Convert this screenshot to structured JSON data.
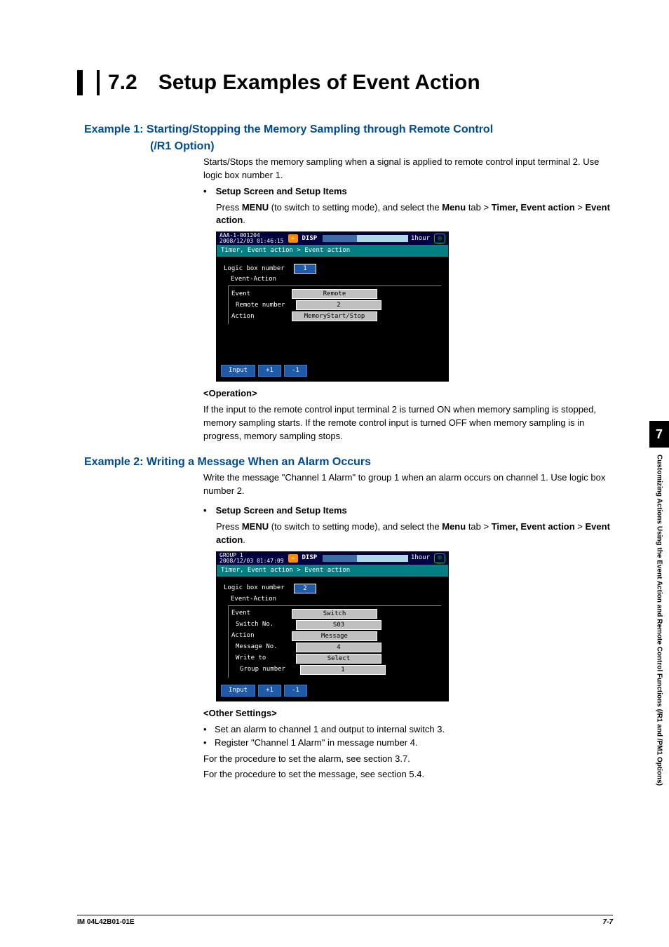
{
  "section": {
    "number": "7.2",
    "title": "Setup Examples of Event Action"
  },
  "example1": {
    "heading_line1": "Example 1: Starting/Stopping the Memory Sampling through Remote Control",
    "heading_line2": "(/R1 Option)",
    "intro": "Starts/Stops the memory sampling when a signal is applied to remote control input terminal 2. Use logic box number 1.",
    "setup_title": "Setup Screen and Setup Items",
    "setup_text_1": "Press ",
    "setup_menu": "MENU",
    "setup_text_2": " (to switch to setting mode), and select the ",
    "setup_menu_tab": "Menu",
    "setup_text_3": " tab > ",
    "setup_path1": "Timer, Event action",
    "setup_sep": " > ",
    "setup_path2": "Event action",
    "operation_title": "<Operation>",
    "operation_text": "If the input to the remote control input terminal 2 is turned ON when memory sampling is stopped, memory sampling starts. If the remote control input is turned OFF when memory sampling is in progress, memory sampling stops.",
    "screenshot": {
      "id_line1": "AAA-1-001204",
      "id_line2": "2008/12/03 01:46:15",
      "disp": "DISP",
      "hour": "1hour",
      "breadcrumb": "Timer, Event action > Event action",
      "rows": {
        "logic_label": "Logic box number",
        "logic_val": "1",
        "group_label": "Event-Action",
        "event_label": "Event",
        "event_val": "Remote",
        "remote_label": "Remote number",
        "remote_val": "2",
        "action_label": "Action",
        "action_val": "MemoryStart/Stop"
      },
      "footer": {
        "input": "Input",
        "plus": "+1",
        "minus": "-1"
      }
    }
  },
  "example2": {
    "heading": "Example 2: Writing a Message When an Alarm Occurs",
    "intro": "Write the message \"Channel 1 Alarm\" to group 1 when an alarm occurs on channel 1. Use logic box number 2.",
    "setup_title": "Setup Screen and Setup Items",
    "setup_text_1": "Press ",
    "setup_menu": "MENU",
    "setup_text_2": " (to switch to setting mode), and select the ",
    "setup_menu_tab": "Menu",
    "setup_text_3": " tab > ",
    "setup_path1": "Timer, Event action",
    "setup_sep": " > ",
    "setup_path2": "Event action",
    "other_title": "<Other Settings>",
    "other_b1": "Set an alarm to channel 1 and output to internal switch 3.",
    "other_b2": "Register \"Channel 1 Alarm\" in message number 4.",
    "other_l3": "For the procedure to set the alarm, see section 3.7.",
    "other_l4": "For the procedure to set the message, see section 5.4.",
    "screenshot": {
      "id_line1": "GROUP 1",
      "id_line2": "2008/12/03 01:47:09",
      "disp": "DISP",
      "hour": "1hour",
      "breadcrumb": "Timer, Event action > Event action",
      "rows": {
        "logic_label": "Logic box number",
        "logic_val": "2",
        "group_label": "Event-Action",
        "event_label": "Event",
        "event_val": "Switch",
        "switch_label": "Switch No.",
        "switch_val": "S03",
        "action_label": "Action",
        "action_val": "Message",
        "msg_label": "Message No.",
        "msg_val": "4",
        "write_label": "Write to",
        "write_val": "Select",
        "group_num_label": "Group number",
        "group_num_val": "1"
      },
      "footer": {
        "input": "Input",
        "plus": "+1",
        "minus": "-1"
      }
    }
  },
  "side": {
    "chapter": "7",
    "text": "Customizing Actions Using the Event Action and Remote Control Functions (/R1 and /PM1 Options)"
  },
  "footer": {
    "left": "IM 04L42B01-01E",
    "right": "7-7"
  }
}
